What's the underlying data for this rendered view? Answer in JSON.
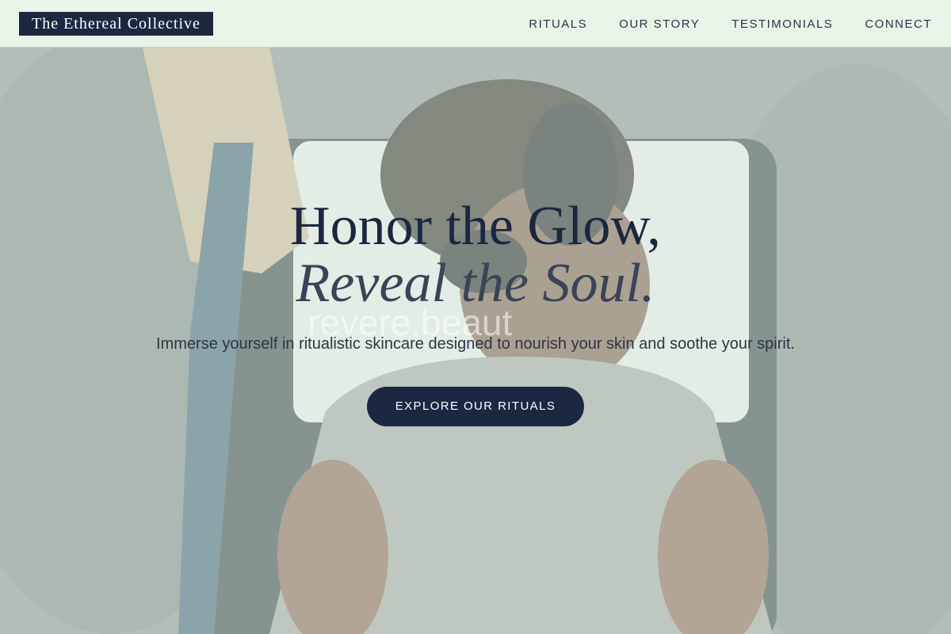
{
  "header": {
    "brand": "The Ethereal Collective",
    "nav": [
      {
        "label": "RITUALS"
      },
      {
        "label": "OUR STORY"
      },
      {
        "label": "TESTIMONIALS"
      },
      {
        "label": "CONNECT"
      }
    ]
  },
  "hero": {
    "title_line1": "Honor the Glow,",
    "title_line2": "Reveal the Soul.",
    "watermark": "revere.beaut",
    "subtitle": "Immerse yourself in ritualistic skincare designed to nourish your skin and soothe your spirit.",
    "cta_label": "EXPLORE OUR RITUALS"
  },
  "colors": {
    "primary_navy": "#1c2841",
    "header_bg": "#ecf7ec",
    "overlay_tint": "#d6e8dc"
  }
}
